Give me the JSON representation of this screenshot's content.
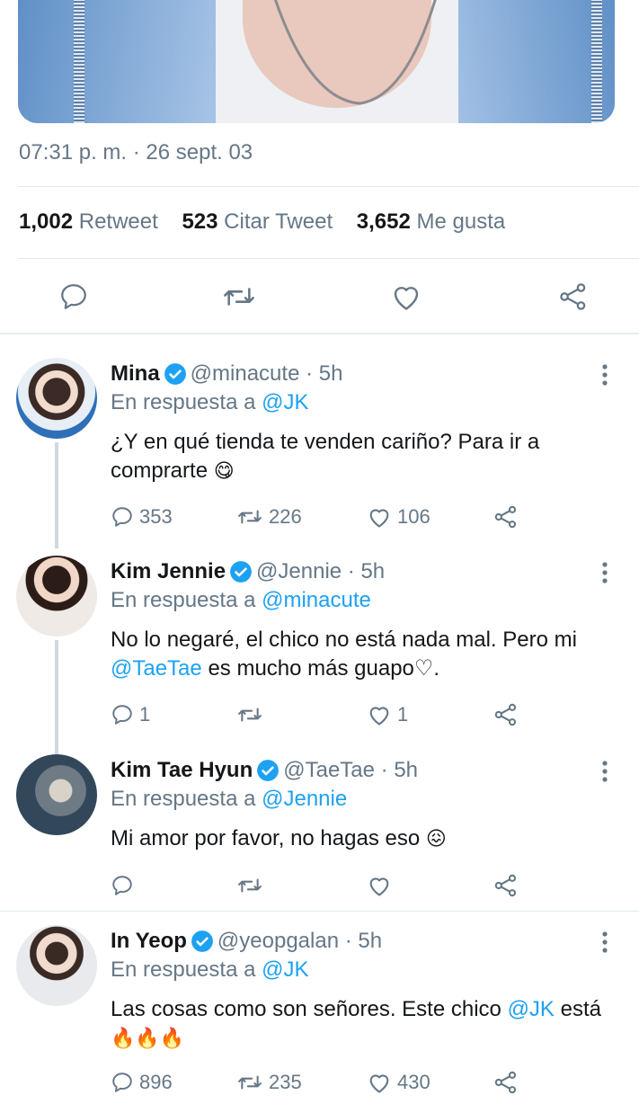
{
  "tweet": {
    "timestamp": "07:31 p. m. · 26 sept. 03",
    "stats": [
      {
        "value": "1,002",
        "label": "Retweet"
      },
      {
        "value": "523",
        "label": "Citar Tweet"
      },
      {
        "value": "3,652",
        "label": "Me gusta"
      }
    ],
    "actions": [
      "reply-icon",
      "retweet-icon",
      "like-icon",
      "share-icon"
    ]
  },
  "colors": {
    "accent": "#1da1f2",
    "muted": "#657786",
    "divider": "#e1e8ed"
  },
  "replies": [
    {
      "name": "Mina",
      "handle": "@minacute · 5h",
      "reply_prefix": "En respuesta a",
      "reply_to": "@JK",
      "text_before": "¿Y en qué tienda te venden cariño? Para ir a comprarte",
      "emoji": "😋",
      "reply_count": "353",
      "retweet_count": "226",
      "like_count": "106"
    },
    {
      "name": "Kim Jennie",
      "handle": "@Jennie · 5h",
      "reply_prefix": "En respuesta a",
      "reply_to": "@minacute",
      "text_before": "No lo negaré, el chico no está nada mal. Pero mi",
      "mention": "@TaeTae",
      "text_after": "es mucho más guapo♡.",
      "reply_count": "1",
      "retweet_count": "",
      "like_count": "1"
    },
    {
      "name": "Kim Tae Hyun",
      "handle": "@TaeTae · 5h",
      "reply_prefix": "En respuesta a",
      "reply_to": "@Jennie",
      "text_before": "Mi amor por favor, no hagas eso",
      "emoji": "😖",
      "reply_count": "",
      "retweet_count": "",
      "like_count": ""
    },
    {
      "name": "In Yeop",
      "handle": "@yeopgalan · 5h",
      "reply_prefix": "En respuesta a",
      "reply_to": "@JK",
      "text_before": "Las cosas como son señores. Este chico",
      "mention": "@JK",
      "text_after": "está",
      "emoji": "🔥🔥🔥",
      "reply_count": "896",
      "retweet_count": "235",
      "like_count": "430"
    }
  ]
}
